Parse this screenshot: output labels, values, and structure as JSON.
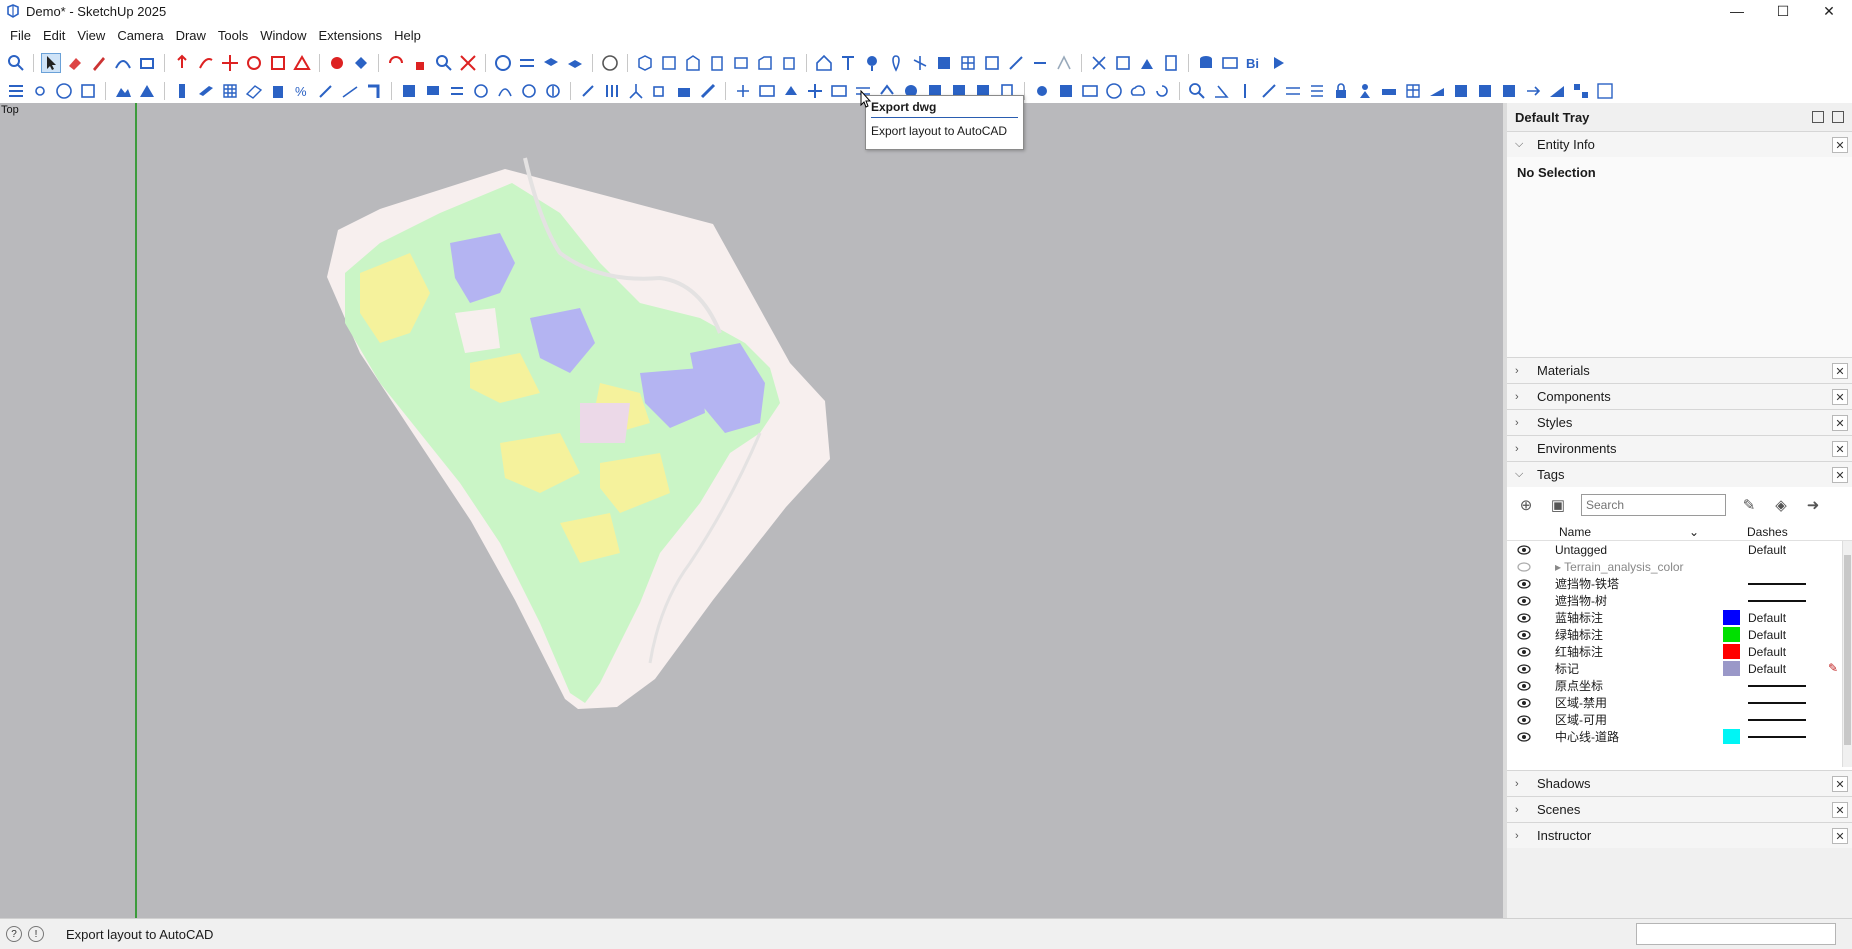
{
  "window": {
    "title": "Demo* - SketchUp 2025",
    "minimize": "—",
    "maximize": "☐",
    "close": "✕"
  },
  "menu": [
    "File",
    "Edit",
    "View",
    "Camera",
    "Draw",
    "Tools",
    "Window",
    "Extensions",
    "Help"
  ],
  "viewport": {
    "view_label": "Top"
  },
  "tooltip": {
    "title": "Export dwg",
    "description": "Export layout to AutoCAD"
  },
  "tray": {
    "title": "Default Tray",
    "panels": {
      "entity_info": "Entity Info",
      "no_selection": "No Selection",
      "materials": "Materials",
      "components": "Components",
      "styles": "Styles",
      "environments": "Environments",
      "tags": "Tags",
      "shadows": "Shadows",
      "scenes": "Scenes",
      "instructor": "Instructor"
    },
    "tags": {
      "search_placeholder": "Search",
      "col_name": "Name",
      "col_dashes": "Dashes",
      "rows": [
        {
          "name": "Untagged",
          "dashes": "Default",
          "color": "",
          "visible": true
        },
        {
          "name": "▸ Terrain_analysis_color",
          "dashes": "",
          "color": "",
          "visible": false
        },
        {
          "name": "遮挡物-铁塔",
          "dashes": "line",
          "color": "",
          "visible": true
        },
        {
          "name": "遮挡物-树",
          "dashes": "line",
          "color": "",
          "visible": true
        },
        {
          "name": "蓝轴标注",
          "dashes": "Default",
          "color": "#0000ff",
          "visible": true
        },
        {
          "name": "绿轴标注",
          "dashes": "Default",
          "color": "#00e000",
          "visible": true
        },
        {
          "name": "红轴标注",
          "dashes": "Default",
          "color": "#ff0000",
          "visible": true
        },
        {
          "name": "标记",
          "dashes": "Default",
          "color": "#9a98c8",
          "visible": true
        },
        {
          "name": "原点坐标",
          "dashes": "line",
          "color": "",
          "visible": true
        },
        {
          "name": "区域-禁用",
          "dashes": "line",
          "color": "",
          "visible": true
        },
        {
          "name": "区域-可用",
          "dashes": "line",
          "color": "",
          "visible": true
        },
        {
          "name": "中心线-道路",
          "dashes": "line",
          "color": "#00f5f5",
          "visible": true
        }
      ]
    }
  },
  "statusbar": {
    "text": "Export layout to AutoCAD"
  }
}
